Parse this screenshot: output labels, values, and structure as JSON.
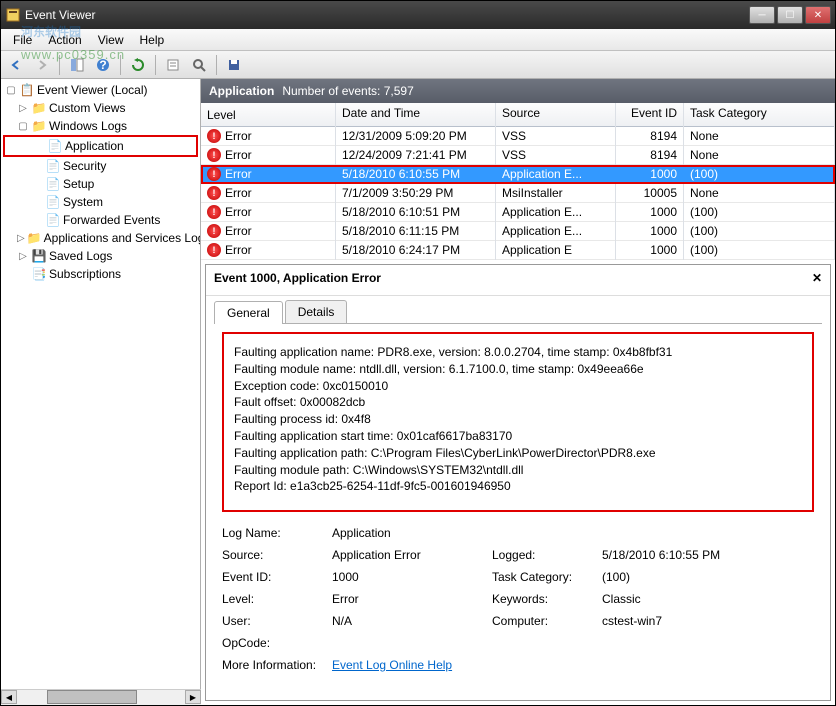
{
  "window": {
    "title": "Event Viewer"
  },
  "menu": {
    "file": "File",
    "action": "Action",
    "view": "View",
    "help": "Help"
  },
  "watermark": {
    "main": "河东软件园",
    "sub": "www.pc0359.cn"
  },
  "tree": {
    "root": "Event Viewer (Local)",
    "custom": "Custom Views",
    "winlogs": "Windows Logs",
    "app": "Application",
    "security": "Security",
    "setup": "Setup",
    "system": "System",
    "forwarded": "Forwarded Events",
    "appservices": "Applications and Services Logs",
    "saved": "Saved Logs",
    "subs": "Subscriptions"
  },
  "header": {
    "name": "Application",
    "count_label": "Number of events: 7,597"
  },
  "columns": {
    "level": "Level",
    "date": "Date and Time",
    "source": "Source",
    "id": "Event ID",
    "task": "Task Category"
  },
  "rows": [
    {
      "level": "Error",
      "date": "12/31/2009 5:09:20 PM",
      "source": "VSS",
      "id": "8194",
      "task": "None"
    },
    {
      "level": "Error",
      "date": "12/24/2009 7:21:41 PM",
      "source": "VSS",
      "id": "8194",
      "task": "None"
    },
    {
      "level": "Error",
      "date": "5/18/2010 6:10:55 PM",
      "source": "Application E...",
      "id": "1000",
      "task": "(100)",
      "selected": true
    },
    {
      "level": "Error",
      "date": "7/1/2009 3:50:29 PM",
      "source": "MsiInstaller",
      "id": "10005",
      "task": "None"
    },
    {
      "level": "Error",
      "date": "5/18/2010 6:10:51 PM",
      "source": "Application E...",
      "id": "1000",
      "task": "(100)"
    },
    {
      "level": "Error",
      "date": "5/18/2010 6:11:15 PM",
      "source": "Application E...",
      "id": "1000",
      "task": "(100)"
    },
    {
      "level": "Error",
      "date": "5/18/2010 6:24:17 PM",
      "source": "Application E",
      "id": "1000",
      "task": "(100)"
    }
  ],
  "detail": {
    "title": "Event 1000, Application Error",
    "tabs": {
      "general": "General",
      "details": "Details"
    },
    "fault": [
      "Faulting application name: PDR8.exe, version: 8.0.0.2704, time stamp: 0x4b8fbf31",
      "Faulting module name: ntdll.dll, version: 6.1.7100.0, time stamp: 0x49eea66e",
      "Exception code: 0xc0150010",
      "Fault offset: 0x00082dcb",
      "Faulting process id: 0x4f8",
      "Faulting application start time: 0x01caf6617ba83170",
      "Faulting application path: C:\\Program Files\\CyberLink\\PowerDirector\\PDR8.exe",
      "Faulting module path: C:\\Windows\\SYSTEM32\\ntdll.dll",
      "Report Id: e1a3cb25-6254-11df-9fc5-001601946950"
    ],
    "props": {
      "logname_l": "Log Name:",
      "logname_v": "Application",
      "source_l": "Source:",
      "source_v": "Application Error",
      "logged_l": "Logged:",
      "logged_v": "5/18/2010 6:10:55 PM",
      "eventid_l": "Event ID:",
      "eventid_v": "1000",
      "taskcat_l": "Task Category:",
      "taskcat_v": "(100)",
      "level_l": "Level:",
      "level_v": "Error",
      "keywords_l": "Keywords:",
      "keywords_v": "Classic",
      "user_l": "User:",
      "user_v": "N/A",
      "computer_l": "Computer:",
      "computer_v": "cstest-win7",
      "opcode_l": "OpCode:",
      "moreinfo_l": "More Information:",
      "moreinfo_link": "Event Log Online Help"
    }
  }
}
